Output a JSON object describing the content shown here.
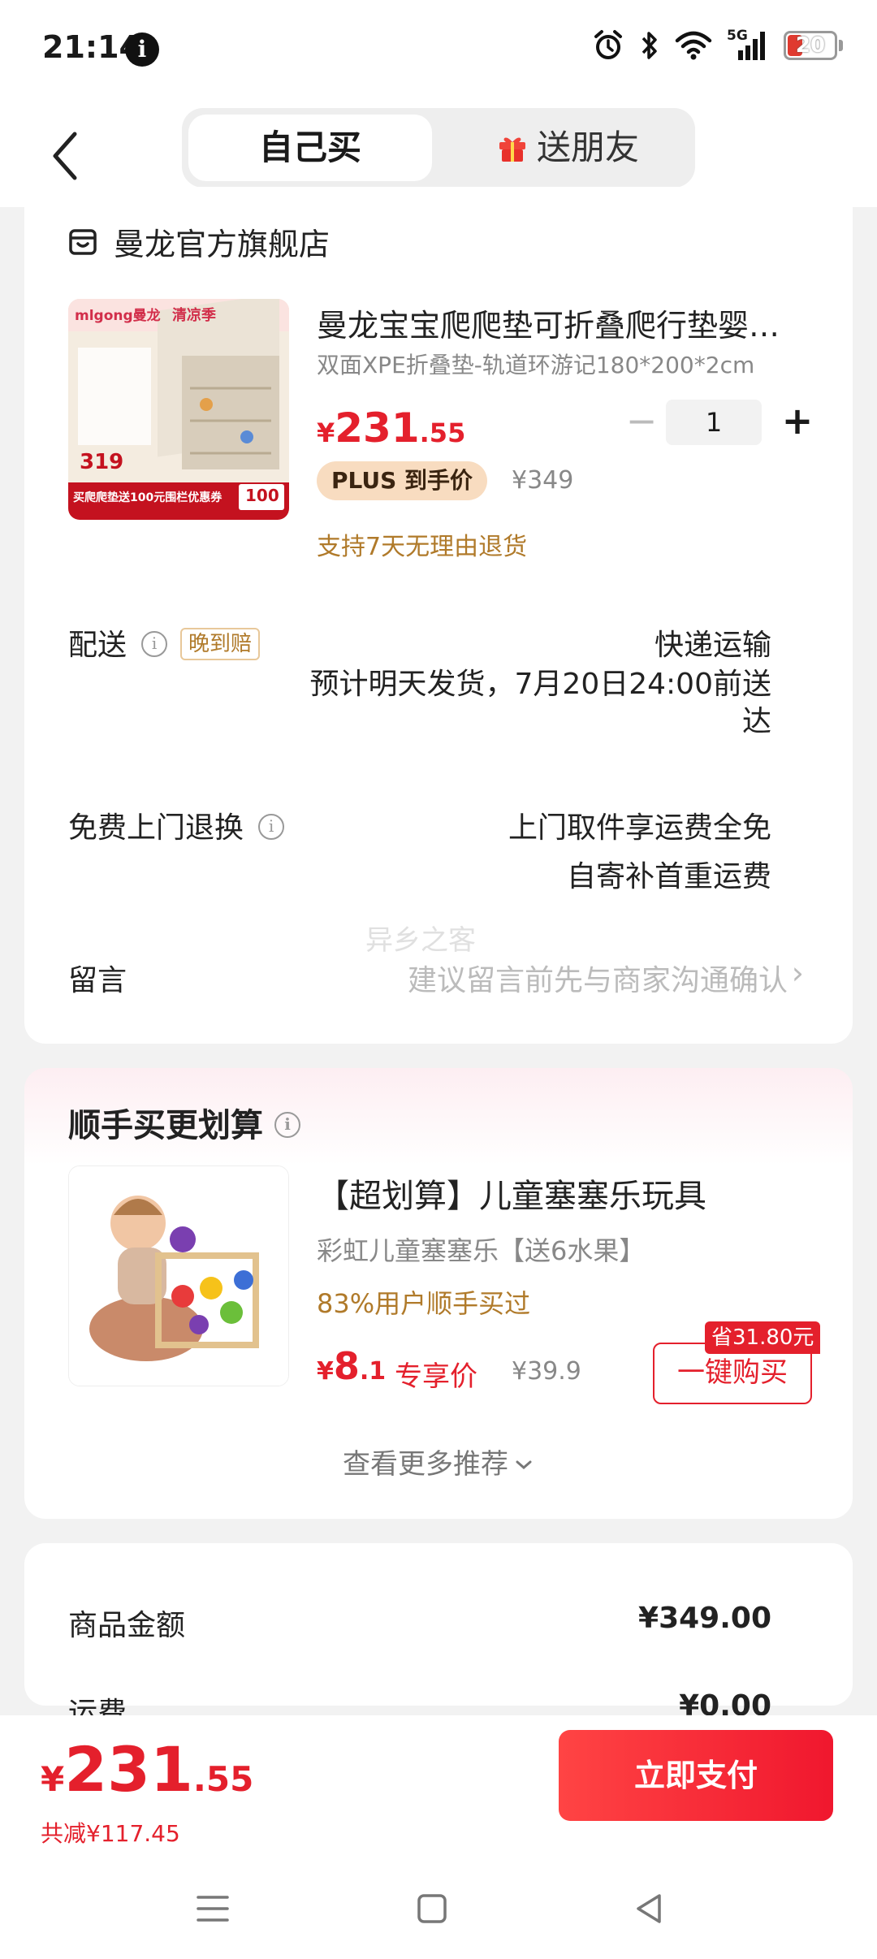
{
  "status": {
    "time": "21:14",
    "info_glyph": "i",
    "network": "5G",
    "battery": "20"
  },
  "nav": {
    "tab_active": "自己买",
    "tab_other": "送朋友"
  },
  "store": {
    "name": "曼龙官方旗舰店"
  },
  "product": {
    "title": "曼龙宝宝爬爬垫可折叠爬行垫婴儿家用地垫",
    "spec": "双面XPE折叠垫-轨道环游记180*200*2cm",
    "price_currency": "¥",
    "price_int": "231",
    "price_dec": ".55",
    "quantity": "1",
    "plus_label": "PLUS 到手价",
    "original_price": "¥349",
    "return_note": "支持7天无理由退货",
    "thumb": {
      "brand": "mlgong曼龙",
      "season": "清凉季",
      "price": "319",
      "coupon_text": "买爬爬垫送100元围栏优惠券",
      "coupon_value": "100"
    }
  },
  "delivery": {
    "label": "配送",
    "badge": "晚到赔",
    "method": "快递运输",
    "estimate": "预计明天发货，7月20日24:00前送达"
  },
  "returns": {
    "label": "免费上门退换",
    "line1": "上门取件享运费全免",
    "line2": "自寄补首重运费"
  },
  "note": {
    "label": "留言",
    "placeholder": "建议留言前先与商家沟通确认",
    "watermark": "异乡之客"
  },
  "recommend": {
    "title": "顺手买更划算",
    "item_name": "【超划算】儿童塞塞乐玩具",
    "item_sub": "彩虹儿童塞塞乐【送6水果】",
    "item_users": "83%用户顺手买过",
    "price_currency": "¥",
    "price_int": "8",
    "price_dec": ".1",
    "exclusive_label": "专享价",
    "original_price": "¥39.9",
    "save_tag": "省31.80元",
    "buy_button": "一键购买",
    "more": "查看更多推荐"
  },
  "summary": {
    "goods_label": "商品金额",
    "goods_value": "¥349.00",
    "shipping_label": "运费",
    "shipping_value": "¥0.00"
  },
  "bottom": {
    "total_currency": "¥",
    "total_int": "231",
    "total_dec": ".55",
    "discount": "共减¥117.45",
    "pay_button": "立即支付"
  },
  "colors": {
    "accent_red": "#e4202c",
    "gold": "#b07a2a"
  }
}
